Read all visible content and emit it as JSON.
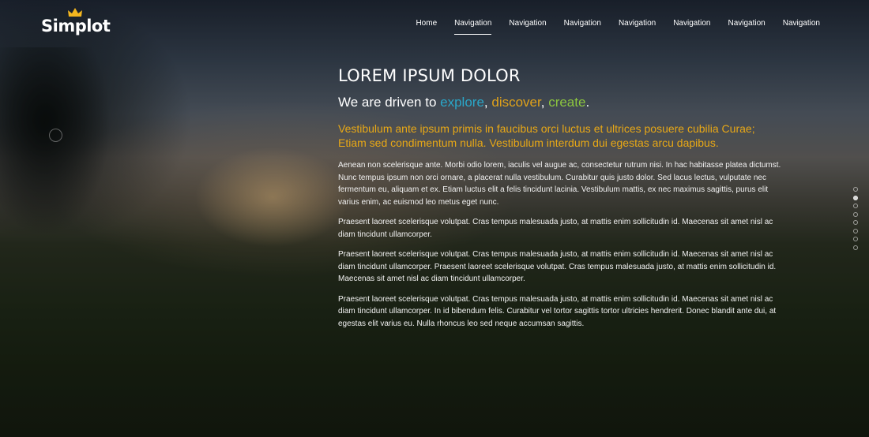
{
  "brand": {
    "logo_text": "Simplot",
    "crown_color": "#f3b61f"
  },
  "nav": {
    "items": [
      {
        "label": "Home"
      },
      {
        "label": "Navigation"
      },
      {
        "label": "Navigation"
      },
      {
        "label": "Navigation"
      },
      {
        "label": "Navigation"
      },
      {
        "label": "Navigation"
      },
      {
        "label": "Navigation"
      },
      {
        "label": "Navigation"
      }
    ],
    "active_index": 1
  },
  "hero": {
    "headline": "LOREM IPSUM DOLOR",
    "tagline": {
      "prefix": "We are driven to ",
      "word1": "explore",
      "sep1": ", ",
      "word2": "discover",
      "sep2": ", ",
      "word3": "create",
      "suffix": "."
    },
    "lead": "Vestibulum ante ipsum primis in faucibus orci luctus et ultrices posuere cubilia Curae; Etiam sed condimentum nulla. Vestibulum interdum dui egestas arcu dapibus.",
    "paragraphs": [
      "Aenean non scelerisque ante. Morbi odio lorem, iaculis vel augue ac, consectetur rutrum nisi. In hac habitasse platea dictumst. Nunc tempus ipsum non orci ornare, a placerat nulla vestibulum. Curabitur quis justo dolor. Sed lacus lectus, vulputate nec fermentum eu, aliquam et ex. Etiam luctus elit a felis tincidunt lacinia. Vestibulum mattis, ex nec maximus sagittis, purus elit varius enim, ac euismod leo metus eget nunc.",
      "Praesent laoreet scelerisque volutpat. Cras tempus malesuada justo, at mattis enim sollicitudin id. Maecenas sit amet nisl ac diam tincidunt ullamcorper.",
      "Praesent laoreet scelerisque volutpat. Cras tempus malesuada justo, at mattis enim sollicitudin id. Maecenas sit amet nisl ac diam tincidunt ullamcorper. Praesent laoreet scelerisque volutpat. Cras tempus malesuada justo, at mattis enim sollicitudin id. Maecenas sit amet nisl ac diam tincidunt ullamcorper.",
      "Praesent laoreet scelerisque volutpat. Cras tempus malesuada justo, at mattis enim sollicitudin id. Maecenas sit amet nisl ac diam tincidunt ullamcorper. In id bibendum felis. Curabitur vel tortor sagittis tortor ultricies hendrerit. Donec blandit ante dui, at egestas elit varius eu. Nulla rhoncus leo sed neque accumsan sagittis."
    ],
    "accent_colors": {
      "explore": "#2aa7c9",
      "discover": "#e0a21a",
      "create": "#8cc63f",
      "lead": "#e8a816"
    }
  },
  "pager": {
    "dot_count": 8,
    "active_index": 1
  }
}
